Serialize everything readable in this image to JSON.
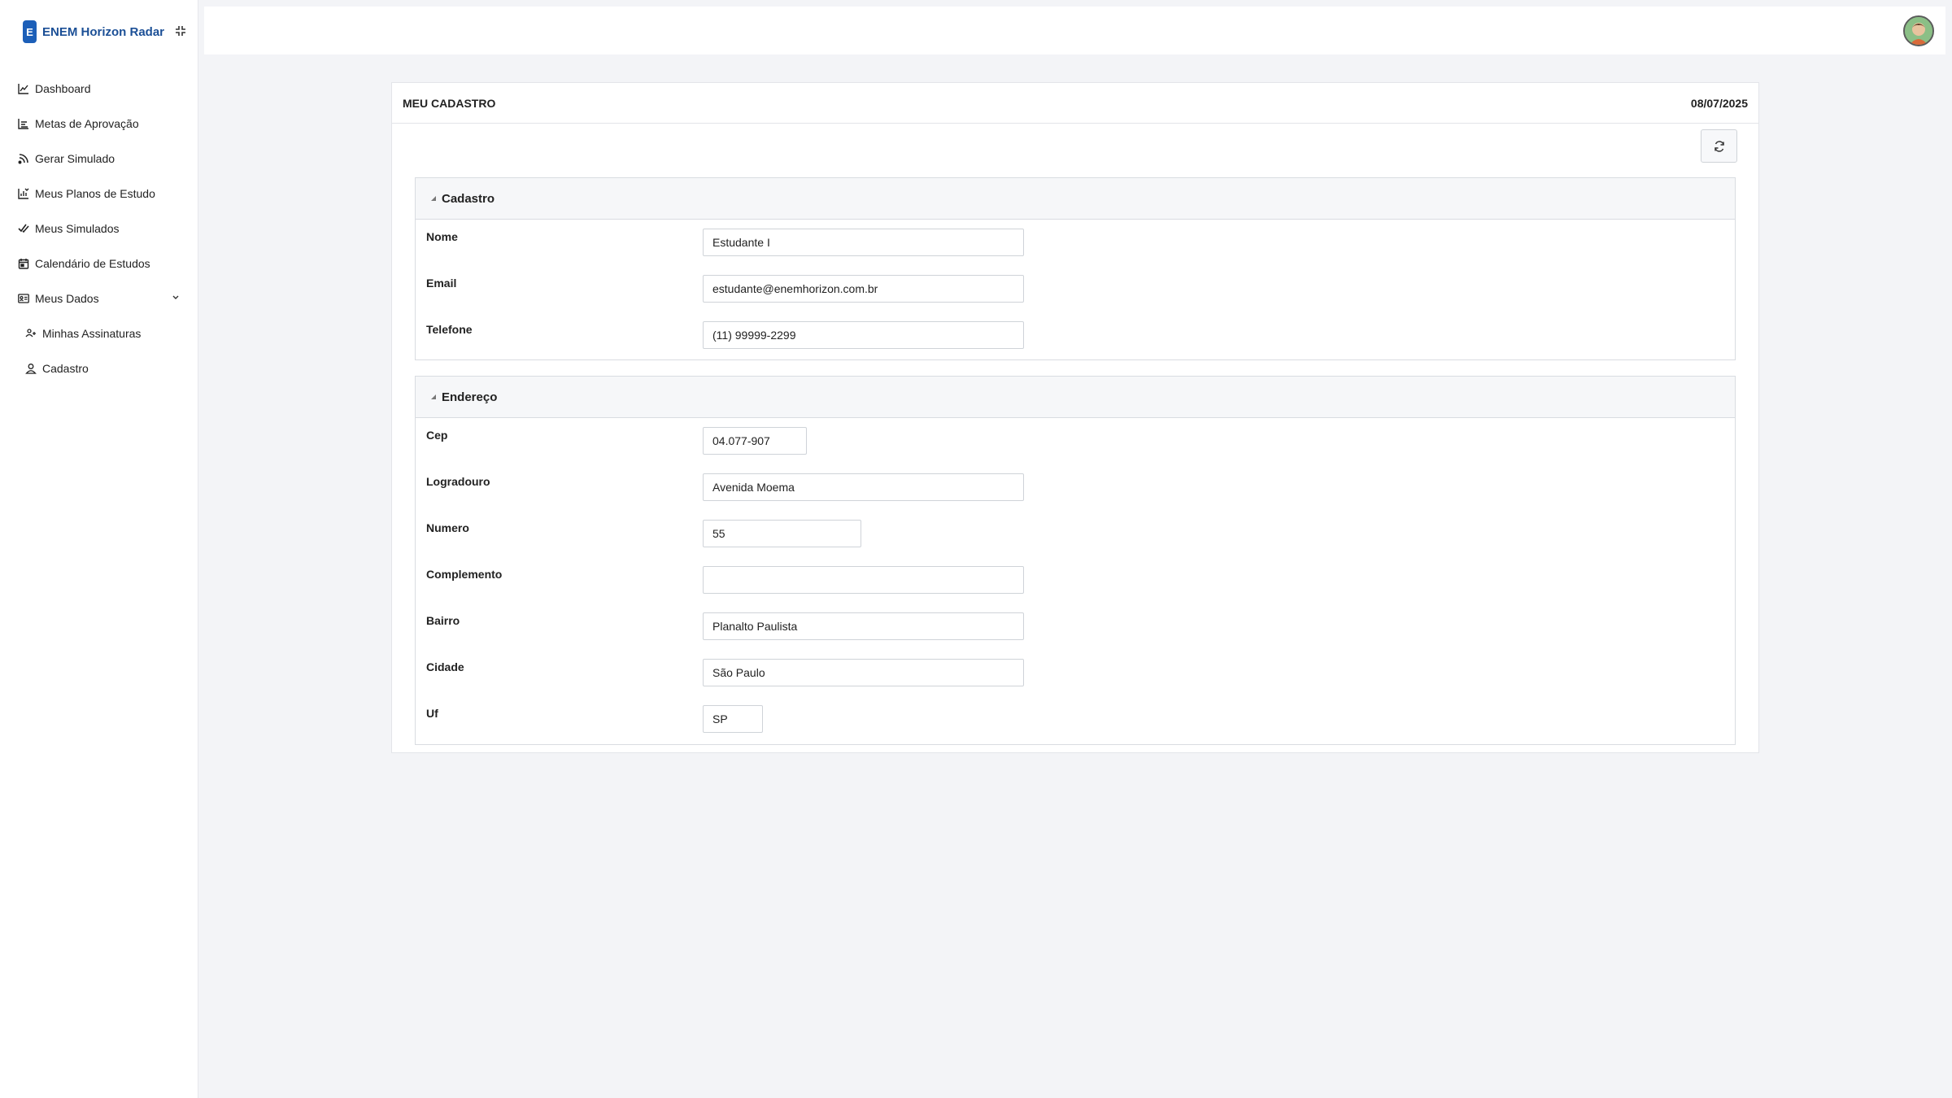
{
  "app": {
    "badge": "E",
    "name": "ENEM Horizon Radar"
  },
  "sidebar": {
    "items": [
      {
        "label": "Dashboard",
        "icon": "line-chart-icon"
      },
      {
        "label": "Metas de Aprovação",
        "icon": "bar-chart-icon"
      },
      {
        "label": "Gerar Simulado",
        "icon": "rss-icon"
      },
      {
        "label": "Meus Planos de Estudo",
        "icon": "plan-chart-icon"
      },
      {
        "label": "Meus Simulados",
        "icon": "double-check-icon"
      },
      {
        "label": "Calendário de Estudos",
        "icon": "calendar-icon"
      },
      {
        "label": "Meus Dados",
        "icon": "id-card-icon",
        "expanded": true
      }
    ],
    "subitems": [
      {
        "label": "Minhas Assinaturas",
        "icon": "subscriptions-icon"
      },
      {
        "label": "Cadastro",
        "icon": "user-icon"
      }
    ]
  },
  "page": {
    "title": "MEU CADASTRO",
    "date": "08/07/2025"
  },
  "cadastro": {
    "title": "Cadastro",
    "fields": [
      {
        "label": "Nome",
        "value": "Estudante I"
      },
      {
        "label": "Email",
        "value": "estudante@enemhorizon.com.br"
      },
      {
        "label": "Telefone",
        "value": "(11) 99999-2299"
      }
    ]
  },
  "endereco": {
    "title": "Endereço",
    "fields": [
      {
        "label": "Cep",
        "value": "04.077-907"
      },
      {
        "label": "Logradouro",
        "value": "Avenida Moema"
      },
      {
        "label": "Numero",
        "value": "55"
      },
      {
        "label": "Complemento",
        "value": ""
      },
      {
        "label": "Bairro",
        "value": "Planalto Paulista"
      },
      {
        "label": "Cidade",
        "value": "São Paulo"
      },
      {
        "label": "Uf",
        "value": "SP"
      }
    ]
  },
  "colors": {
    "brand": "#1c5fb8",
    "background": "#f3f4f7"
  }
}
